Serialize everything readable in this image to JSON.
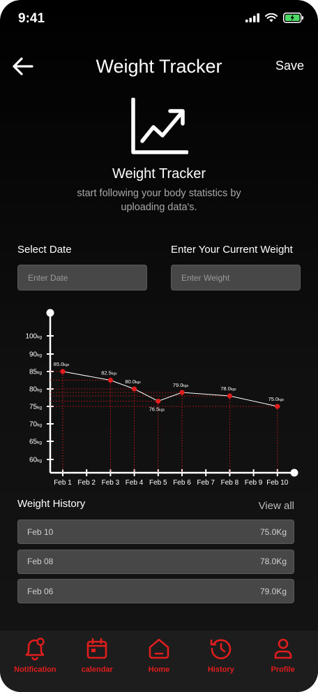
{
  "status_bar": {
    "time": "9:41"
  },
  "header": {
    "title": "Weight Tracker",
    "save_label": "Save"
  },
  "hero": {
    "icon": "chart-trend-icon",
    "title": "Weight Tracker",
    "subtitle": "start following your body statistics by uploading data's."
  },
  "form": {
    "date_label": "Select Date",
    "date_placeholder": "Enter Date",
    "weight_label": "Enter Your Current Weight",
    "weight_placeholder": "Enter Weight"
  },
  "colors": {
    "accent": "#e11d1d",
    "background": "#000000",
    "field": "#474747",
    "nav": "#1d1d1d"
  },
  "chart_data": {
    "type": "line",
    "categories": [
      "Feb 1",
      "Feb 2",
      "Feb 3",
      "Feb 4",
      "Feb 5",
      "Feb 6",
      "Feb 7",
      "Feb 8",
      "Feb 9",
      "Feb 10"
    ],
    "y_ticks": [
      60,
      65,
      70,
      75,
      80,
      85,
      90,
      100
    ],
    "y_unit": "kg",
    "points": [
      {
        "category": "Feb 1",
        "value": 85.0,
        "label": "85.0",
        "unit": "kgs"
      },
      {
        "category": "Feb 3",
        "value": 82.5,
        "label": "82.5",
        "unit": "kgs"
      },
      {
        "category": "Feb 4",
        "value": 80.0,
        "label": "80.0",
        "unit": "kgs"
      },
      {
        "category": "Feb 5",
        "value": 76.5,
        "label": "76.5",
        "unit": "kgs"
      },
      {
        "category": "Feb 6",
        "value": 79.0,
        "label": "79.0",
        "unit": "kgs"
      },
      {
        "category": "Feb 8",
        "value": 78.0,
        "label": "78.0",
        "unit": "kgs"
      },
      {
        "category": "Feb 10",
        "value": 75.0,
        "label": "75.0",
        "unit": "kgs"
      }
    ],
    "grid": false,
    "legend": "none"
  },
  "history": {
    "title": "Weight History",
    "view_all_label": "View all",
    "items": [
      {
        "date": "Feb 10",
        "weight": "75.0Kg"
      },
      {
        "date": "Feb 08",
        "weight": "78.0Kg"
      },
      {
        "date": "Feb 06",
        "weight": "79.0Kg"
      }
    ]
  },
  "nav": {
    "items": [
      {
        "label": "Notification",
        "icon": "bell-icon"
      },
      {
        "label": "calendar",
        "icon": "calendar-icon"
      },
      {
        "label": "Home",
        "icon": "home-icon"
      },
      {
        "label": "History",
        "icon": "history-icon"
      },
      {
        "label": "Profile",
        "icon": "profile-icon"
      }
    ]
  }
}
